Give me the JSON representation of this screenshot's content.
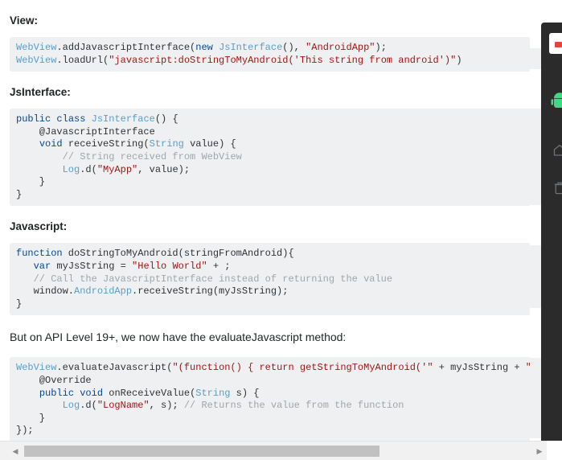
{
  "document": {
    "sections": [
      {
        "id": "view",
        "heading": "View:",
        "code_lines": [
          [
            {
              "t": "WebView",
              "c": "t-type"
            },
            {
              "t": ".addJavascriptInterface(",
              "c": "t-plain"
            },
            {
              "t": "new",
              "c": "t-kw"
            },
            {
              "t": " ",
              "c": "t-plain"
            },
            {
              "t": "JsInterface",
              "c": "t-type"
            },
            {
              "t": "(), ",
              "c": "t-plain"
            },
            {
              "t": "\"AndroidApp\"",
              "c": "t-str"
            },
            {
              "t": ");",
              "c": "t-plain"
            }
          ],
          [
            {
              "t": "WebView",
              "c": "t-type"
            },
            {
              "t": ".loadUrl(",
              "c": "t-plain"
            },
            {
              "t": "\"javascript:doStringToMyAndroid('This string from android')\"",
              "c": "t-str"
            },
            {
              "t": ")",
              "c": "t-plain"
            }
          ]
        ]
      },
      {
        "id": "jsinterface",
        "heading": "JsInterface:",
        "code_lines": [
          [
            {
              "t": "public",
              "c": "t-kw"
            },
            {
              "t": " ",
              "c": "t-plain"
            },
            {
              "t": "class",
              "c": "t-kw"
            },
            {
              "t": " ",
              "c": "t-plain"
            },
            {
              "t": "JsInterface",
              "c": "t-type"
            },
            {
              "t": "() {",
              "c": "t-plain"
            }
          ],
          [
            {
              "t": "    @JavascriptInterface",
              "c": "t-ann"
            }
          ],
          [
            {
              "t": "    ",
              "c": "t-plain"
            },
            {
              "t": "void",
              "c": "t-kw"
            },
            {
              "t": " receiveString(",
              "c": "t-plain"
            },
            {
              "t": "String",
              "c": "t-type"
            },
            {
              "t": " value) {",
              "c": "t-plain"
            }
          ],
          [
            {
              "t": "        // String received from WebView",
              "c": "t-com"
            }
          ],
          [
            {
              "t": "        ",
              "c": "t-plain"
            },
            {
              "t": "Log",
              "c": "t-type"
            },
            {
              "t": ".d(",
              "c": "t-plain"
            },
            {
              "t": "\"MyApp\"",
              "c": "t-str"
            },
            {
              "t": ", value);",
              "c": "t-plain"
            }
          ],
          [
            {
              "t": "    }",
              "c": "t-plain"
            }
          ],
          [
            {
              "t": "}",
              "c": "t-plain"
            }
          ]
        ]
      },
      {
        "id": "javascript",
        "heading": "Javascript:",
        "code_lines": [
          [
            {
              "t": "function",
              "c": "t-kw"
            },
            {
              "t": " doStringToMyAndroid(stringFromAndroid){",
              "c": "t-plain"
            }
          ],
          [
            {
              "t": "   ",
              "c": "t-plain"
            },
            {
              "t": "var",
              "c": "t-kw"
            },
            {
              "t": " myJsString = ",
              "c": "t-plain"
            },
            {
              "t": "\"Hello World\"",
              "c": "t-str"
            },
            {
              "t": " + ;",
              "c": "t-plain"
            }
          ],
          [
            {
              "t": "   // Call the JavascriptInterface instead of returning the value",
              "c": "t-com"
            }
          ],
          [
            {
              "t": "   window.",
              "c": "t-plain"
            },
            {
              "t": "AndroidApp",
              "c": "t-type"
            },
            {
              "t": ".receiveString(myJsString);",
              "c": "t-plain"
            }
          ],
          [
            {
              "t": "}",
              "c": "t-plain"
            }
          ]
        ]
      }
    ],
    "paragraph": "But on API Level 19+, we now have the evaluateJavascript method:",
    "final_code_lines": [
      [
        {
          "t": "WebView",
          "c": "t-type"
        },
        {
          "t": ".evaluateJavascript(",
          "c": "t-plain"
        },
        {
          "t": "\"(function() { ",
          "c": "t-str"
        },
        {
          "t": "return",
          "c": "t-ret"
        },
        {
          "t": " getStringToMyAndroid('\"",
          "c": "t-str"
        },
        {
          "t": " + myJsString + ",
          "c": "t-plain"
        },
        {
          "t": "\"');",
          "c": "t-str"
        }
      ],
      [
        {
          "t": "    @Override",
          "c": "t-ann"
        }
      ],
      [
        {
          "t": "    ",
          "c": "t-plain"
        },
        {
          "t": "public",
          "c": "t-kw"
        },
        {
          "t": " ",
          "c": "t-plain"
        },
        {
          "t": "void",
          "c": "t-kw"
        },
        {
          "t": " onReceiveValue(",
          "c": "t-plain"
        },
        {
          "t": "String",
          "c": "t-type"
        },
        {
          "t": " s) {",
          "c": "t-plain"
        }
      ],
      [
        {
          "t": "        ",
          "c": "t-plain"
        },
        {
          "t": "Log",
          "c": "t-type"
        },
        {
          "t": ".d(",
          "c": "t-plain"
        },
        {
          "t": "\"LogName\"",
          "c": "t-str"
        },
        {
          "t": ", s); ",
          "c": "t-plain"
        },
        {
          "t": "// Returns the value from the function",
          "c": "t-com"
        }
      ],
      [
        {
          "t": "    }",
          "c": "t-plain"
        }
      ],
      [
        {
          "t": "});",
          "c": "t-plain"
        }
      ]
    ]
  },
  "right_panel": {
    "background_color": "#2b2b2b",
    "icons": [
      {
        "name": "app-tile-icon",
        "glyph": "",
        "color": "#e8433a"
      },
      {
        "name": "android-robot-icon",
        "glyph": "",
        "color": "#3ddc84"
      },
      {
        "name": "home-outline-icon",
        "glyph": "⌂",
        "color": "#6f7276"
      },
      {
        "name": "trash-outline-icon",
        "glyph": "▯",
        "color": "#6f7276"
      }
    ]
  },
  "scrollbars": {
    "horizontal": {
      "left_arrow": "◀",
      "right_arrow": "▶",
      "thumb_color": "#c1c1c1",
      "track_color": "#f1f1f1"
    },
    "vertical": {
      "track_color": "#eff0f1"
    }
  }
}
